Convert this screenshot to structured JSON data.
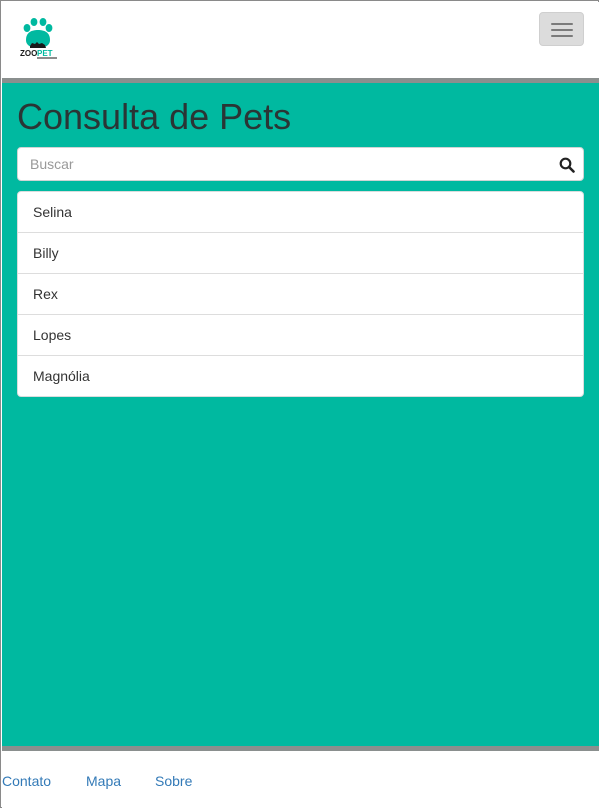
{
  "navbar": {
    "logo_icon": "zoopet-paw-logo",
    "logo_text_dark": "ZOO",
    "logo_text_accent": "PET",
    "menu_icon": "hamburger-menu-icon"
  },
  "colors": {
    "accent": "#00b9a0",
    "title": "#2a3535",
    "link": "#337ab7"
  },
  "main": {
    "title": "Consulta de Pets",
    "search": {
      "placeholder": "Buscar",
      "value": "",
      "icon": "search-icon"
    },
    "pets": [
      "Selina",
      "Billy",
      "Rex",
      "Lopes",
      "Magnólia"
    ]
  },
  "footer": {
    "links": [
      "Contato",
      "Mapa",
      "Sobre"
    ]
  }
}
